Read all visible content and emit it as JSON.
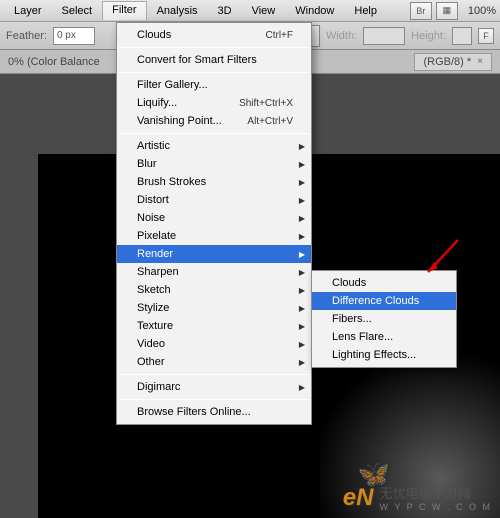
{
  "menubar": {
    "items": [
      "Layer",
      "Select",
      "Filter",
      "Analysis",
      "3D",
      "View",
      "Window",
      "Help"
    ],
    "active_index": 2,
    "zoom": "100%",
    "icon1": "Br",
    "icon2": "▦"
  },
  "toolbar": {
    "feather_label": "Feather:",
    "feather_value": "0 px",
    "width_label": "Width:",
    "height_label": "Height:",
    "btn": "F"
  },
  "tabbar": {
    "left_text": "0% (Color Balance",
    "tab_label": "(RGB/8) *",
    "close": "×"
  },
  "filter_menu": {
    "last": {
      "label": "Clouds",
      "shortcut": "Ctrl+F"
    },
    "convert": "Convert for Smart Filters",
    "gallery": "Filter Gallery...",
    "liquify": {
      "label": "Liquify...",
      "shortcut": "Shift+Ctrl+X"
    },
    "vanishing": {
      "label": "Vanishing Point...",
      "shortcut": "Alt+Ctrl+V"
    },
    "groups": [
      "Artistic",
      "Blur",
      "Brush Strokes",
      "Distort",
      "Noise",
      "Pixelate",
      "Render",
      "Sharpen",
      "Sketch",
      "Stylize",
      "Texture",
      "Video",
      "Other"
    ],
    "hl_index": 6,
    "digimarc": "Digimarc",
    "browse": "Browse Filters Online..."
  },
  "render_submenu": {
    "items": [
      "Clouds",
      "Difference Clouds",
      "Fibers...",
      "Lens Flare...",
      "Lighting Effects..."
    ],
    "hl_index": 1
  },
  "watermark": {
    "logo": "eN",
    "text": "无忧电脑学习网",
    "url": "W Y P C W . C O M"
  }
}
